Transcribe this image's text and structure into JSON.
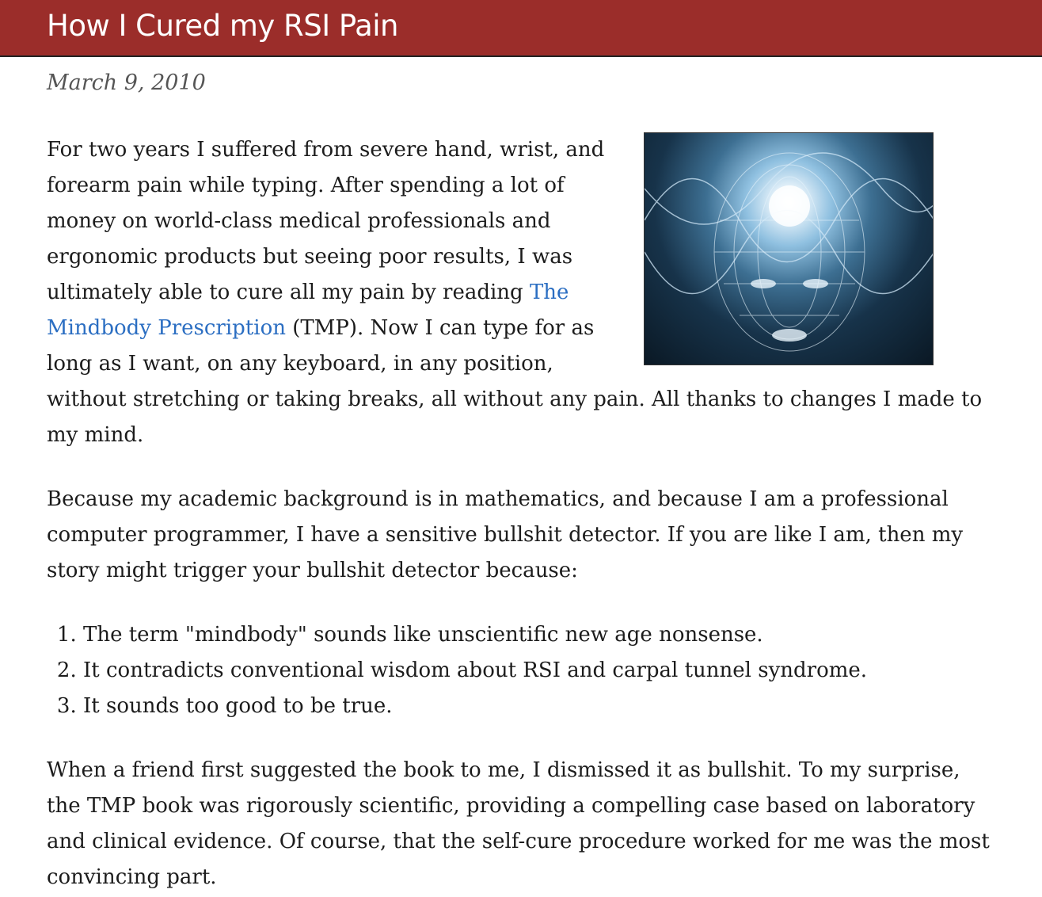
{
  "page": {
    "title": "How I Cured my RSI Pain",
    "date": "March 9, 2010"
  },
  "post": {
    "p1_before": "For two years I suffered from severe hand, wrist, and forearm pain while typing. After spending a lot of money on world-class medical professionals and ergonomic products but seeing poor results, I was ultimately able to cure all my pain by reading ",
    "p1_link": "The Mindbody Prescription",
    "p1_after": " (TMP). Now I can type for as long as I want, on any keyboard, in any position, without stretching or taking breaks, all without any pain. All thanks to changes I made to my mind.",
    "p2": "Because my academic background is in mathematics, and because I am a professional computer programmer, I have a sensitive bullshit detector. If you are like I am, then my story might trigger your bullshit detector because:",
    "list": [
      "The term \"mindbody\" sounds like unscientific new age nonsense.",
      "It contradicts conventional wisdom about RSI and carpal tunnel syndrome.",
      "It sounds too good to be true."
    ],
    "p3": "When a friend first suggested the book to me, I dismissed it as bullshit. To my surprise, the TMP book was rigorously scientific, providing a compelling case based on laboratory and clinical evidence. Of course, that the self-cure procedure worked for me was the most convincing part."
  },
  "colors": {
    "header_bg": "#9b2d2a",
    "link": "#2b6ec2"
  }
}
